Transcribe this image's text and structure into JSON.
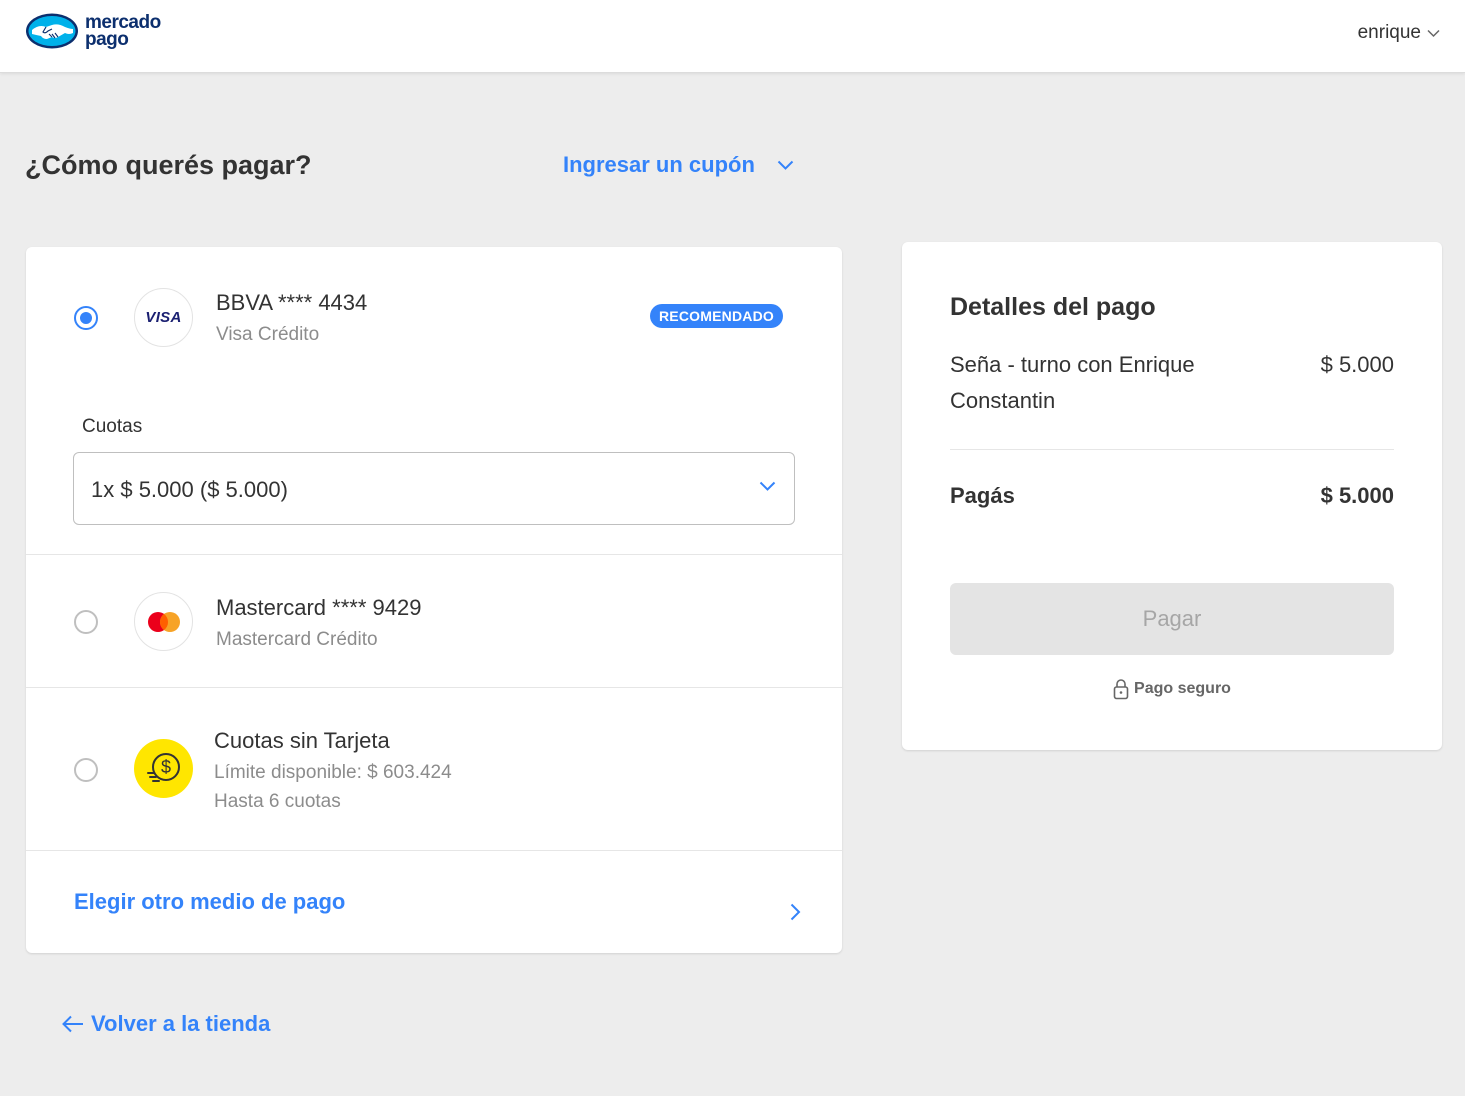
{
  "header": {
    "logo_line1": "mercado",
    "logo_line2": "pago",
    "user_name": "enrique"
  },
  "page": {
    "title": "¿Cómo querés pagar?",
    "coupon_label": "Ingresar un cupón"
  },
  "methods": [
    {
      "title": "BBVA **** 4434",
      "subtitle": "Visa Crédito",
      "badge": "RECOMENDADO",
      "brand_text": "VISA",
      "icon": "visa-logo",
      "selected": true
    },
    {
      "title": "Mastercard **** 9429",
      "subtitle": "Mastercard Crédito",
      "icon": "mastercard-logo",
      "selected": false
    },
    {
      "title": "Cuotas sin Tarjeta",
      "subtitle": "Límite disponible: $ 603.424",
      "subtitle2": "Hasta 6 cuotas",
      "icon": "coin-dollar-icon",
      "selected": false
    }
  ],
  "cuotas": {
    "label": "Cuotas",
    "selected_value": "1x $ 5.000 ($ 5.000)"
  },
  "other_method_label": "Elegir otro medio de pago",
  "back_label": "Volver a la tienda",
  "summary": {
    "title": "Detalles del pago",
    "item_label": "Seña - turno con Enrique Constantin",
    "item_amount": "$ 5.000",
    "total_label": "Pagás",
    "total_amount": "$ 5.000",
    "pay_button": "Pagar",
    "secure_label": "Pago seguro"
  },
  "colors": {
    "accent": "#3483fa",
    "brand_navy": "#0c2f6e",
    "background": "#ededed",
    "coin_yellow": "#ffe600"
  }
}
